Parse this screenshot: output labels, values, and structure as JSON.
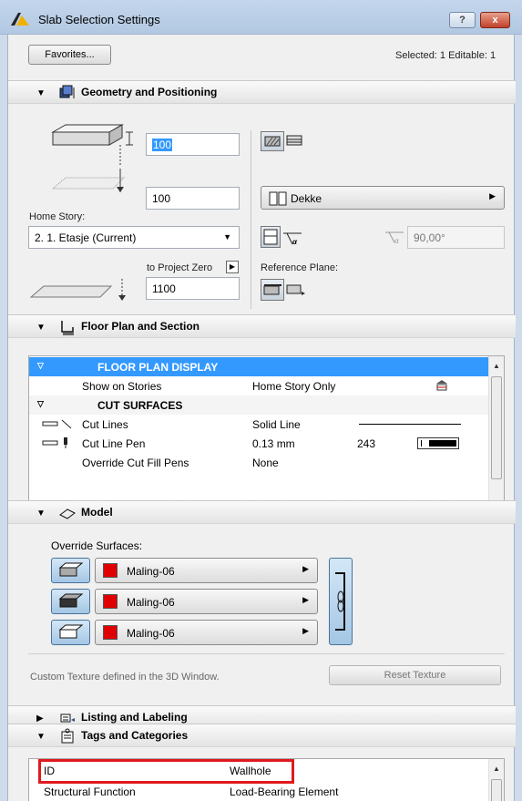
{
  "window": {
    "title": "Slab Selection Settings",
    "help_label": "?",
    "close_label": "x"
  },
  "top": {
    "favorites_label": "Favorites...",
    "selection_info": "Selected: 1 Editable: 1"
  },
  "geometry": {
    "title": "Geometry and Positioning",
    "thickness": "100",
    "offset_to_home": "100",
    "home_story_label": "Home Story:",
    "home_story_value": "2. 1. Etasje (Current)",
    "to_project_zero_label": "to Project Zero",
    "project_zero_value": "1100",
    "composite_value": "Dekke",
    "angle_value": "90,00°",
    "reference_plane_label": "Reference Plane:"
  },
  "floor_plan": {
    "title": "Floor Plan and Section",
    "rows": [
      {
        "type": "header",
        "name": "FLOOR PLAN DISPLAY",
        "value": "",
        "extra": ""
      },
      {
        "type": "item",
        "name": "Show on Stories",
        "value": "Home Story Only",
        "extra": ""
      },
      {
        "type": "group",
        "name": "CUT SURFACES",
        "value": "",
        "extra": ""
      },
      {
        "type": "item",
        "name": "Cut Lines",
        "value": "Solid Line",
        "extra": ""
      },
      {
        "type": "item",
        "name": "Cut Line Pen",
        "value": "0.13 mm",
        "extra": "243"
      },
      {
        "type": "item",
        "name": "Override Cut Fill Pens",
        "value": "None",
        "extra": ""
      }
    ]
  },
  "model": {
    "title": "Model",
    "override_label": "Override Surfaces:",
    "surfaces": [
      "Maling-06",
      "Maling-06",
      "Maling-06"
    ],
    "texture_note": "Custom Texture defined in the 3D Window.",
    "reset_label": "Reset Texture"
  },
  "listing": {
    "title": "Listing and Labeling"
  },
  "tags": {
    "title": "Tags and Categories",
    "rows": [
      {
        "name": "ID",
        "value": "Wallhole"
      },
      {
        "name": "Structural Function",
        "value": "Load-Bearing Element"
      }
    ]
  },
  "colors": {
    "selection_blue": "#3399ff",
    "highlight_red": "#e0191e",
    "surface_red": "#e00000"
  }
}
